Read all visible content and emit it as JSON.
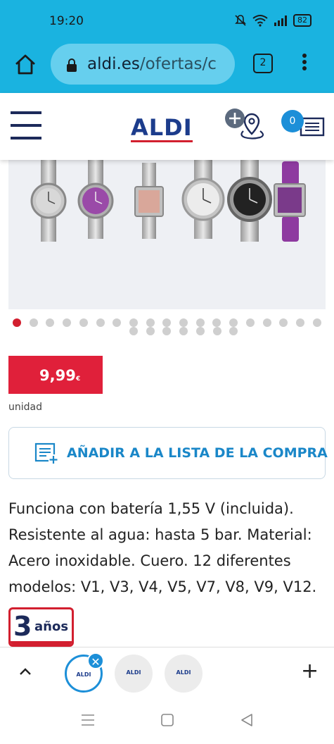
{
  "status_bar": {
    "time": "19:20",
    "battery": "82",
    "icons": [
      "mute-icon",
      "wifi-icon",
      "signal-icon",
      "battery-icon"
    ]
  },
  "browser": {
    "url_domain": "aldi.es",
    "url_path": "/ofertas/c",
    "tab_count": "2"
  },
  "site_header": {
    "logo_text": "ALDI",
    "cart_count": "0"
  },
  "gallery": {
    "watch_count": 6,
    "dot_count": 26,
    "active_dot_index": 0
  },
  "product": {
    "price": "9,99",
    "currency": "€",
    "unit": "unidad",
    "add_to_list_label": "AÑADIR A LA LISTA DE LA COMPRA",
    "description": "Funciona con batería 1,55 V (incluida). Resistente al agua: hasta 5 bar. Material: Acero inoxidable. Cuero. 12 diferentes modelos: V1, V3, V4, V5, V7, V8, V9, V12.",
    "guarantee_number": "3",
    "guarantee_text": "años"
  },
  "tab_bar": {
    "tabs": [
      {
        "label": "ALDI",
        "active": true
      },
      {
        "label": "ALDI",
        "active": false
      },
      {
        "label": "ALDI",
        "active": false
      }
    ]
  },
  "colors": {
    "brand_blue": "#1c3c8c",
    "brand_red": "#d21f2f",
    "accent_blue": "#1a87c8",
    "browser_bar": "#1ab3e0"
  }
}
